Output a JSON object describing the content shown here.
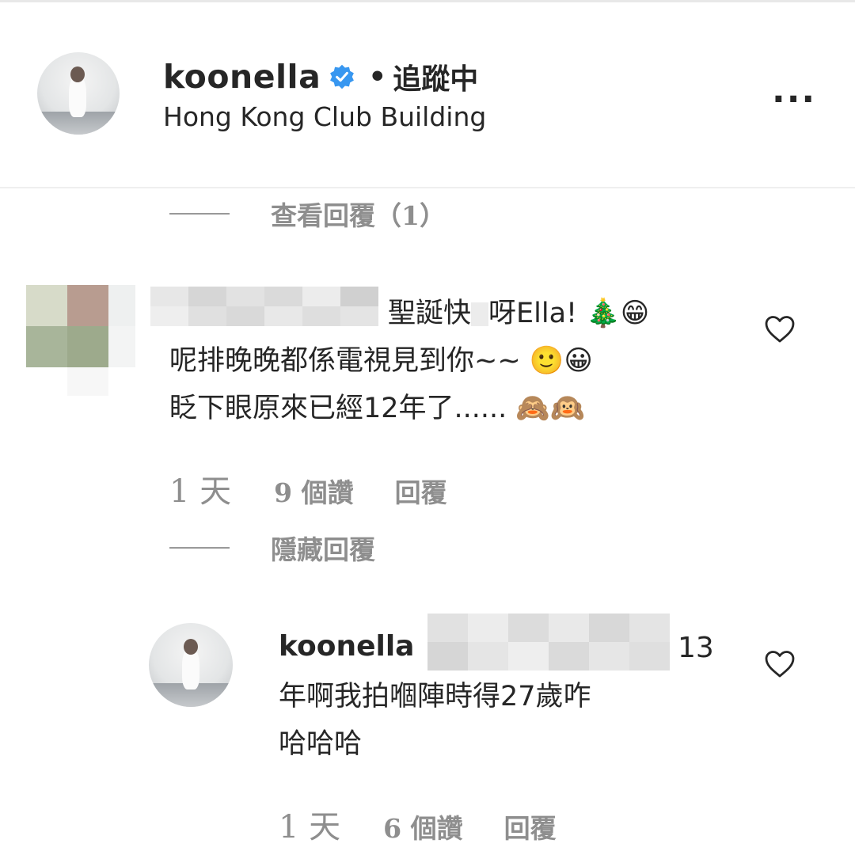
{
  "header": {
    "username": "koonella",
    "separator": "•",
    "follow_label": "追蹤中",
    "location": "Hong Kong Club Building",
    "more_label": "..."
  },
  "view_replies": "查看回覆（1）",
  "comment": {
    "line1_tail": "聖誕快",
    "line1_tail2": "呀Ella! 🎄😁",
    "line2": "呢排晚晚都係電視見到你~~ 🙂😀",
    "line3": "眨下眼原來已經12年了...... 🙈🙉",
    "time": "1 天",
    "likes": "9 個讚",
    "reply": "回覆"
  },
  "hide_replies": "隱藏回覆",
  "reply_comment": {
    "username": "koonella",
    "number": "13",
    "line2": "年啊我拍嗰陣時得27歲咋",
    "line3": "哈哈哈",
    "time": "1 天",
    "likes": "6 個讚",
    "reply": "回覆"
  }
}
